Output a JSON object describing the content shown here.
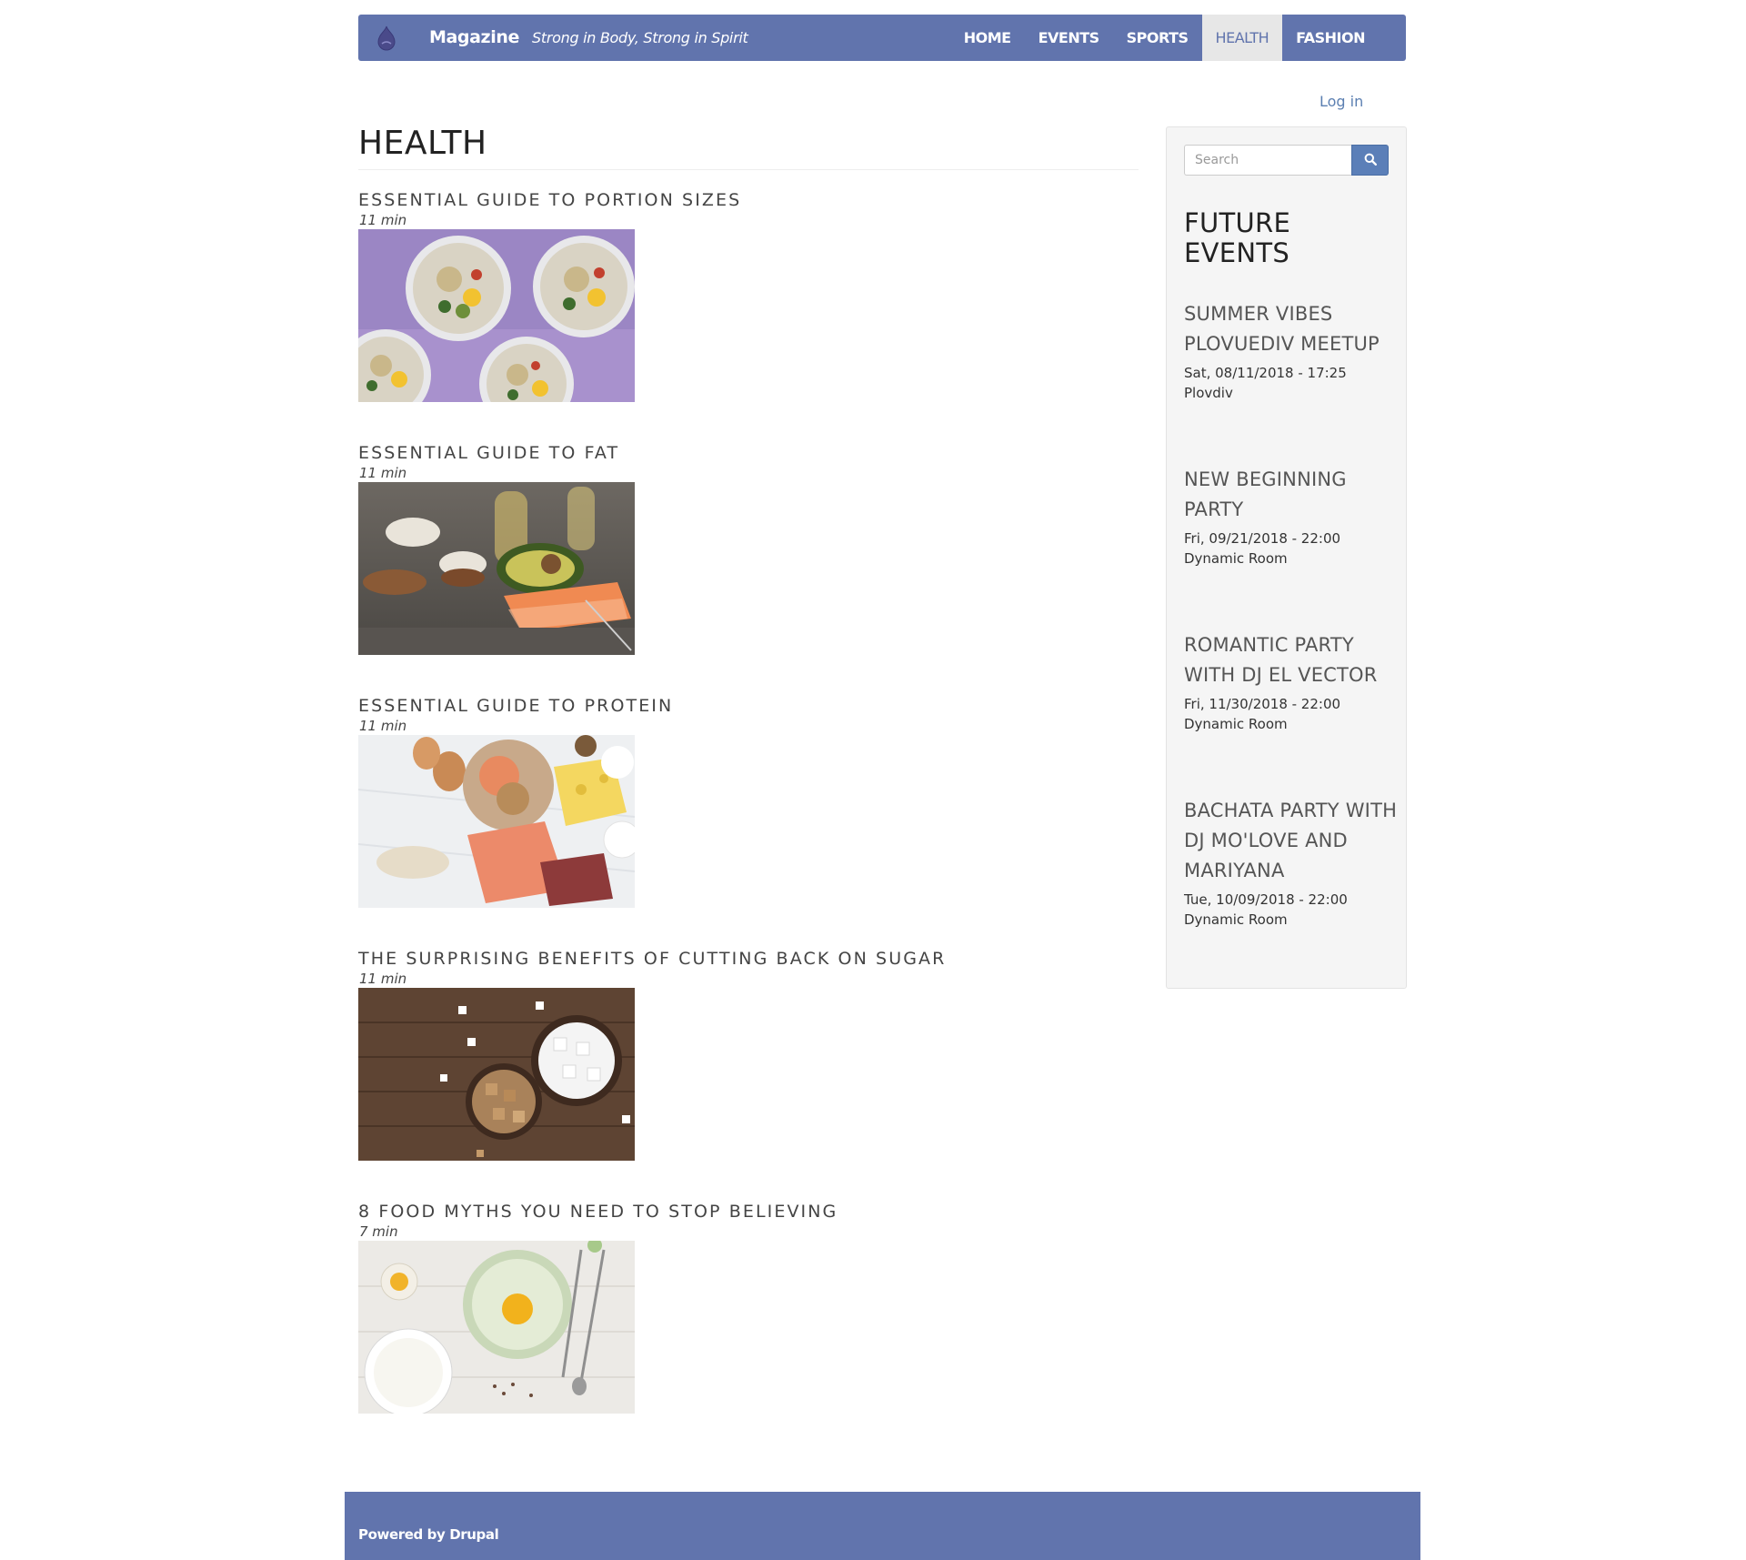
{
  "site": {
    "name": "Magazine",
    "slogan": "Strong in Body, Strong in Spirit"
  },
  "nav": {
    "items": [
      {
        "label": "HOME",
        "active": false
      },
      {
        "label": "EVENTS",
        "active": false
      },
      {
        "label": "SPORTS",
        "active": false
      },
      {
        "label": "HEALTH",
        "active": true
      },
      {
        "label": "FASHION",
        "active": false
      }
    ]
  },
  "user": {
    "login_label": "Log in"
  },
  "page": {
    "title": "HEALTH"
  },
  "articles": [
    {
      "title": "ESSENTIAL GUIDE TO PORTION SIZES",
      "read_time": "11 min",
      "image": "bowls-of-salad-on-purple"
    },
    {
      "title": "ESSENTIAL GUIDE TO FAT",
      "read_time": "11 min",
      "image": "salmon-avocado-nuts-oil"
    },
    {
      "title": "ESSENTIAL GUIDE TO PROTEIN",
      "read_time": "11 min",
      "image": "eggs-shrimp-cheese-salmon"
    },
    {
      "title": "THE SURPRISING BENEFITS OF CUTTING BACK ON SUGAR",
      "read_time": "11 min",
      "image": "sugar-cubes-on-wood"
    },
    {
      "title": "8 FOOD MYTHS YOU NEED TO STOP BELIEVING",
      "read_time": "7 min",
      "image": "egg-yolk-bowl-milk-whisk"
    }
  ],
  "sidebar": {
    "search": {
      "placeholder": "Search",
      "value": ""
    },
    "title": "FUTURE EVENTS",
    "events": [
      {
        "title": "SUMMER VIBES PLOVUEDIV MEETUP",
        "date": "Sat, 08/11/2018 - 17:25",
        "location": "Plovdiv"
      },
      {
        "title": "NEW BEGINNING PARTY",
        "date": "Fri, 09/21/2018 - 22:00",
        "location": "Dynamic Room"
      },
      {
        "title": "ROMANTIC PARTY WITH DJ EL VECTOR",
        "date": "Fri, 11/30/2018 - 22:00",
        "location": "Dynamic Room"
      },
      {
        "title": "BACHATA PARTY WITH DJ MO'LOVE AND MARIYANA",
        "date": "Tue, 10/09/2018 - 22:00",
        "location": "Dynamic Room"
      }
    ]
  },
  "footer": {
    "text": "Powered by Drupal"
  },
  "colors": {
    "brand": "#6174ad",
    "link": "#5b7fb1",
    "sidebar_bg": "#f5f5f5",
    "search_button": "#5b7fb8"
  },
  "icons": {
    "logo": "drupal-drop-icon",
    "search": "search-icon"
  }
}
